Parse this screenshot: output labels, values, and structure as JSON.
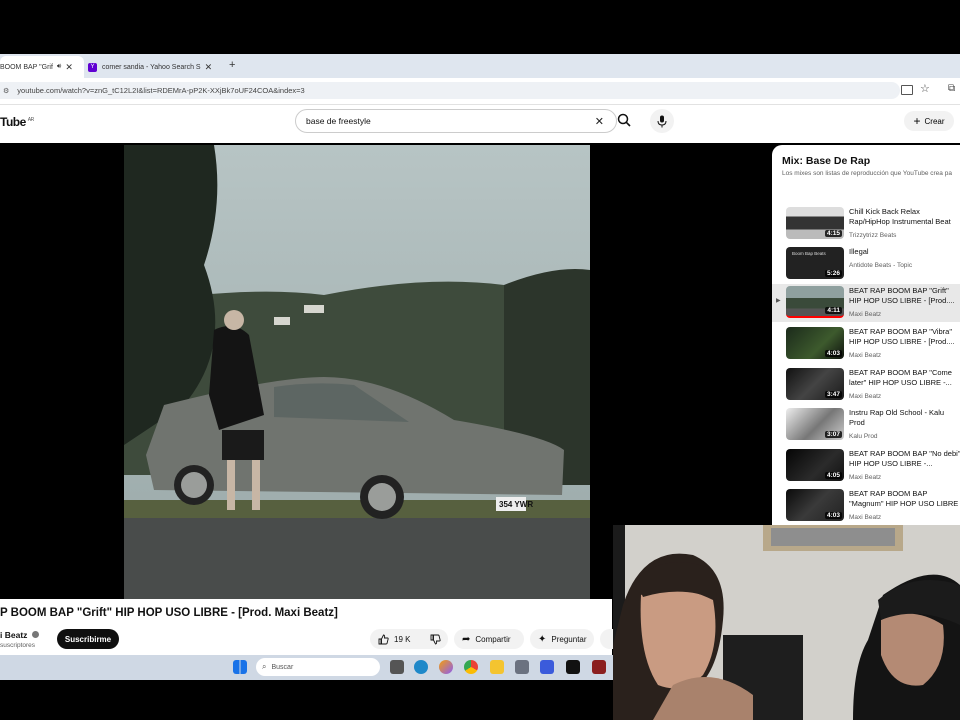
{
  "browser": {
    "tabs": [
      {
        "title": "BOOM BAP \"Grif"
      },
      {
        "title": "comer sandia - Yahoo Search S"
      }
    ],
    "new_tab": "+",
    "close_glyph": "✕",
    "url": "youtube.com/watch?v=znG_tC12L2I&list=RDEMrA-pP2K-XXjBk7oUF24COA&index=3"
  },
  "youtube": {
    "logo_text": "Tube",
    "logo_region": "AR",
    "search": {
      "query": "base de freestyle",
      "clear_glyph": "✕"
    },
    "create_label": "Crear",
    "create_glyph": "+"
  },
  "video": {
    "plate": "354 YWR",
    "title": "P BOOM BAP \"Grift\" HIP HOP USO LIBRE - [Prod. Maxi Beatz]",
    "channel": "i Beatz",
    "subscribers": "suscriptores",
    "subscribe_label": "Suscribirme",
    "likes": "19 K",
    "share_label": "Compartir",
    "ask_label": "Preguntar"
  },
  "playlist": {
    "title": "Mix: Base De Rap",
    "subtitle": "Los mixes son listas de reproducción que YouTube crea pa",
    "now_playing_glyph": "▶",
    "items": [
      {
        "title": "Chill Kick Back Relax Rap/HipHop Instrumental Beat",
        "author": "Trizzytrizz Beats",
        "duration": "4:15",
        "thumb_text": ""
      },
      {
        "title": "Illegal",
        "author": "Antidote Beats - Topic",
        "duration": "5:26",
        "thumb_text": "Boom Bap Beats"
      },
      {
        "title": "BEAT RAP BOOM BAP \"Grift\" HIP HOP USO LIBRE - [Prod....",
        "author": "Maxi Beatz",
        "duration": "4:11",
        "thumb_text": ""
      },
      {
        "title": "BEAT RAP BOOM BAP \"Vibra\" HIP HOP USO LIBRE - [Prod....",
        "author": "Maxi Beatz",
        "duration": "4:03",
        "thumb_text": ""
      },
      {
        "title": "BEAT RAP BOOM BAP \"Come later\" HIP HOP USO LIBRE -...",
        "author": "Maxi Beatz",
        "duration": "3:47",
        "thumb_text": ""
      },
      {
        "title": "Instru Rap Old School - Kalu Prod",
        "author": "Kalu Prod",
        "duration": "3:07",
        "thumb_text": ""
      },
      {
        "title": "BEAT RAP BOOM BAP \"No debi\" HIP HOP USO LIBRE -...",
        "author": "Maxi Beatz",
        "duration": "4:05",
        "thumb_text": ""
      },
      {
        "title": "BEAT RAP BOOM BAP \"Magnum\" HIP HOP USO LIBRE -...",
        "author": "Maxi Beatz",
        "duration": "4:03",
        "thumb_text": ""
      }
    ]
  },
  "taskbar": {
    "search_placeholder": "Buscar"
  },
  "colors": {
    "accent_red": "#ff0000",
    "subscribe_bg": "#0f0f0f",
    "taskbar_bg": "#cfd8e4"
  }
}
